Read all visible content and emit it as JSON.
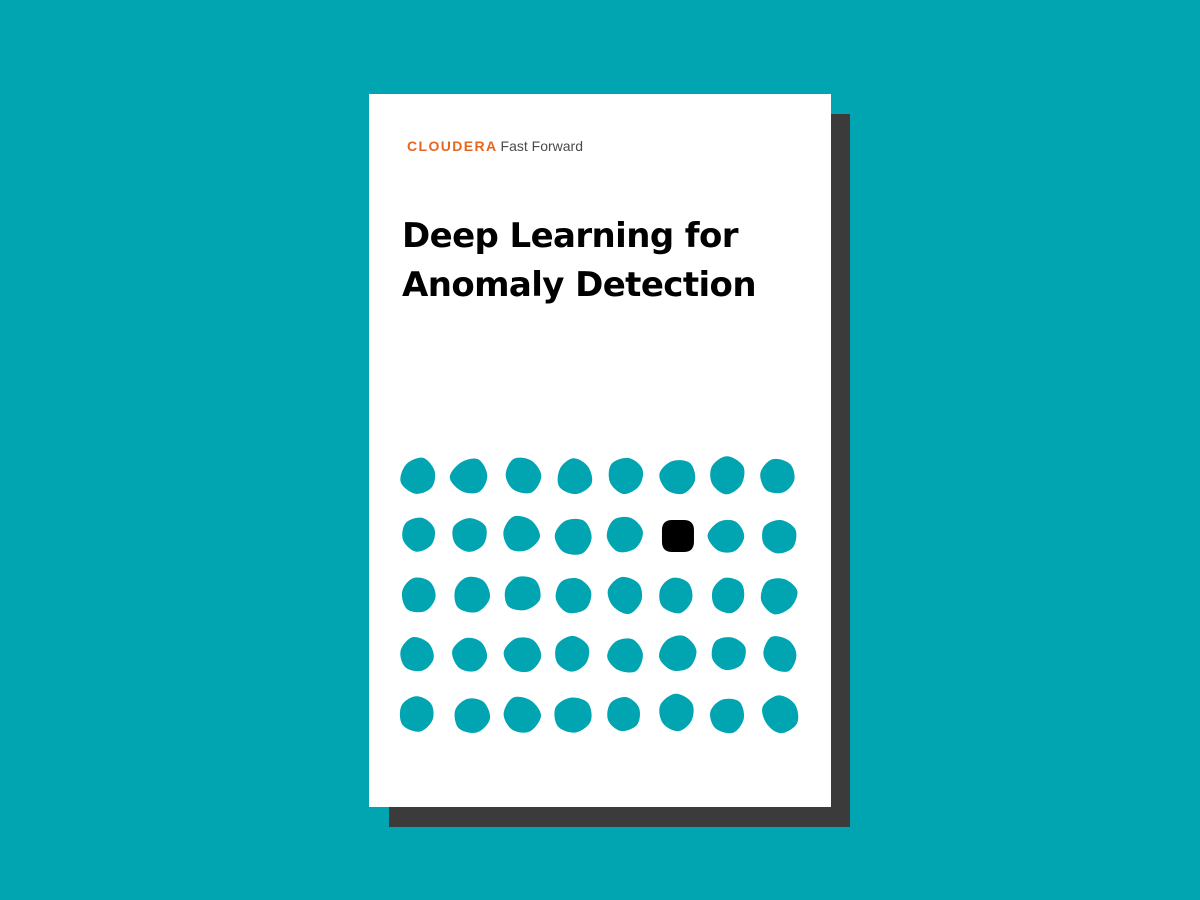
{
  "brand": {
    "name": "CLOUDERA",
    "suffix": "Fast Forward"
  },
  "title": {
    "line1": "Deep Learning for",
    "line2": "Anomaly Detection"
  },
  "colors": {
    "background": "#01a5b2",
    "blob": "#01a5b2",
    "anomaly_blob": "#000000",
    "brand_accent": "#e8651f",
    "cover": "#ffffff",
    "shadow": "#3b3b3b"
  },
  "grid": {
    "rows": 5,
    "columns": 8,
    "anomaly": {
      "row": 2,
      "column": 6
    }
  }
}
